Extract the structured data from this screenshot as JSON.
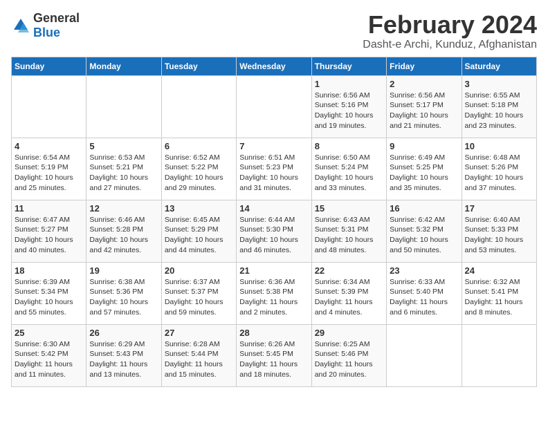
{
  "header": {
    "logo_general": "General",
    "logo_blue": "Blue",
    "title": "February 2024",
    "subtitle": "Dasht-e Archi, Kunduz, Afghanistan"
  },
  "weekdays": [
    "Sunday",
    "Monday",
    "Tuesday",
    "Wednesday",
    "Thursday",
    "Friday",
    "Saturday"
  ],
  "weeks": [
    [
      {
        "day": "",
        "info": ""
      },
      {
        "day": "",
        "info": ""
      },
      {
        "day": "",
        "info": ""
      },
      {
        "day": "",
        "info": ""
      },
      {
        "day": "1",
        "info": "Sunrise: 6:56 AM\nSunset: 5:16 PM\nDaylight: 10 hours\nand 19 minutes."
      },
      {
        "day": "2",
        "info": "Sunrise: 6:56 AM\nSunset: 5:17 PM\nDaylight: 10 hours\nand 21 minutes."
      },
      {
        "day": "3",
        "info": "Sunrise: 6:55 AM\nSunset: 5:18 PM\nDaylight: 10 hours\nand 23 minutes."
      }
    ],
    [
      {
        "day": "4",
        "info": "Sunrise: 6:54 AM\nSunset: 5:19 PM\nDaylight: 10 hours\nand 25 minutes."
      },
      {
        "day": "5",
        "info": "Sunrise: 6:53 AM\nSunset: 5:21 PM\nDaylight: 10 hours\nand 27 minutes."
      },
      {
        "day": "6",
        "info": "Sunrise: 6:52 AM\nSunset: 5:22 PM\nDaylight: 10 hours\nand 29 minutes."
      },
      {
        "day": "7",
        "info": "Sunrise: 6:51 AM\nSunset: 5:23 PM\nDaylight: 10 hours\nand 31 minutes."
      },
      {
        "day": "8",
        "info": "Sunrise: 6:50 AM\nSunset: 5:24 PM\nDaylight: 10 hours\nand 33 minutes."
      },
      {
        "day": "9",
        "info": "Sunrise: 6:49 AM\nSunset: 5:25 PM\nDaylight: 10 hours\nand 35 minutes."
      },
      {
        "day": "10",
        "info": "Sunrise: 6:48 AM\nSunset: 5:26 PM\nDaylight: 10 hours\nand 37 minutes."
      }
    ],
    [
      {
        "day": "11",
        "info": "Sunrise: 6:47 AM\nSunset: 5:27 PM\nDaylight: 10 hours\nand 40 minutes."
      },
      {
        "day": "12",
        "info": "Sunrise: 6:46 AM\nSunset: 5:28 PM\nDaylight: 10 hours\nand 42 minutes."
      },
      {
        "day": "13",
        "info": "Sunrise: 6:45 AM\nSunset: 5:29 PM\nDaylight: 10 hours\nand 44 minutes."
      },
      {
        "day": "14",
        "info": "Sunrise: 6:44 AM\nSunset: 5:30 PM\nDaylight: 10 hours\nand 46 minutes."
      },
      {
        "day": "15",
        "info": "Sunrise: 6:43 AM\nSunset: 5:31 PM\nDaylight: 10 hours\nand 48 minutes."
      },
      {
        "day": "16",
        "info": "Sunrise: 6:42 AM\nSunset: 5:32 PM\nDaylight: 10 hours\nand 50 minutes."
      },
      {
        "day": "17",
        "info": "Sunrise: 6:40 AM\nSunset: 5:33 PM\nDaylight: 10 hours\nand 53 minutes."
      }
    ],
    [
      {
        "day": "18",
        "info": "Sunrise: 6:39 AM\nSunset: 5:34 PM\nDaylight: 10 hours\nand 55 minutes."
      },
      {
        "day": "19",
        "info": "Sunrise: 6:38 AM\nSunset: 5:36 PM\nDaylight: 10 hours\nand 57 minutes."
      },
      {
        "day": "20",
        "info": "Sunrise: 6:37 AM\nSunset: 5:37 PM\nDaylight: 10 hours\nand 59 minutes."
      },
      {
        "day": "21",
        "info": "Sunrise: 6:36 AM\nSunset: 5:38 PM\nDaylight: 11 hours\nand 2 minutes."
      },
      {
        "day": "22",
        "info": "Sunrise: 6:34 AM\nSunset: 5:39 PM\nDaylight: 11 hours\nand 4 minutes."
      },
      {
        "day": "23",
        "info": "Sunrise: 6:33 AM\nSunset: 5:40 PM\nDaylight: 11 hours\nand 6 minutes."
      },
      {
        "day": "24",
        "info": "Sunrise: 6:32 AM\nSunset: 5:41 PM\nDaylight: 11 hours\nand 8 minutes."
      }
    ],
    [
      {
        "day": "25",
        "info": "Sunrise: 6:30 AM\nSunset: 5:42 PM\nDaylight: 11 hours\nand 11 minutes."
      },
      {
        "day": "26",
        "info": "Sunrise: 6:29 AM\nSunset: 5:43 PM\nDaylight: 11 hours\nand 13 minutes."
      },
      {
        "day": "27",
        "info": "Sunrise: 6:28 AM\nSunset: 5:44 PM\nDaylight: 11 hours\nand 15 minutes."
      },
      {
        "day": "28",
        "info": "Sunrise: 6:26 AM\nSunset: 5:45 PM\nDaylight: 11 hours\nand 18 minutes."
      },
      {
        "day": "29",
        "info": "Sunrise: 6:25 AM\nSunset: 5:46 PM\nDaylight: 11 hours\nand 20 minutes."
      },
      {
        "day": "",
        "info": ""
      },
      {
        "day": "",
        "info": ""
      }
    ]
  ]
}
